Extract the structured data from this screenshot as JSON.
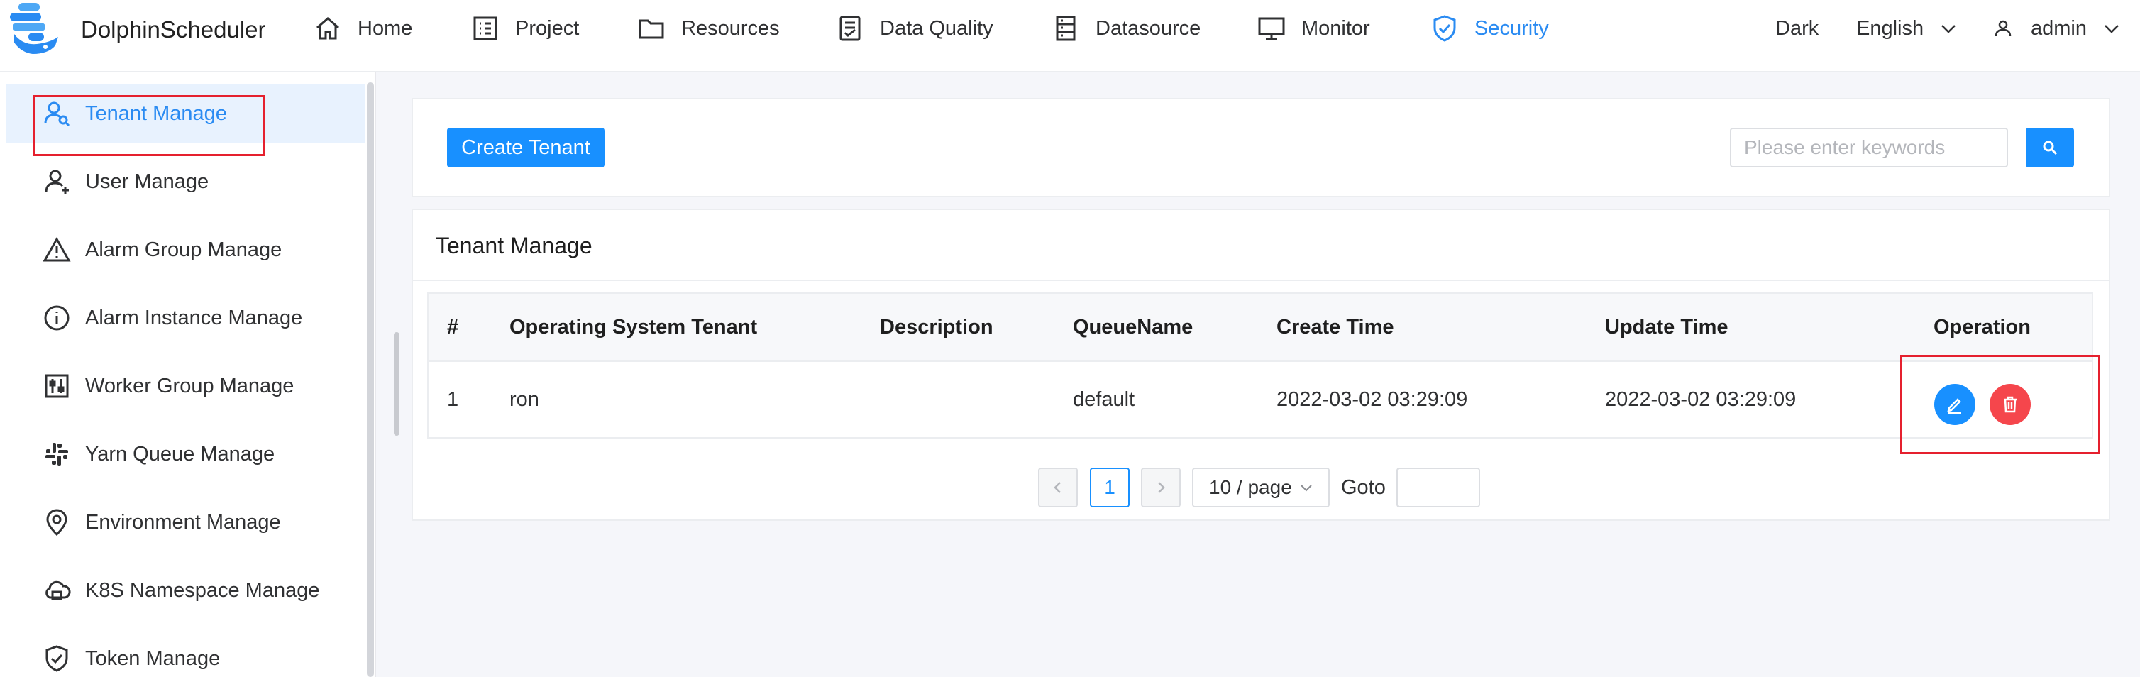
{
  "app": {
    "name": "DolphinScheduler"
  },
  "nav": {
    "items": [
      {
        "label": "Home",
        "icon": "home-icon"
      },
      {
        "label": "Project",
        "icon": "project-icon"
      },
      {
        "label": "Resources",
        "icon": "folder-icon"
      },
      {
        "label": "Data Quality",
        "icon": "data-quality-icon"
      },
      {
        "label": "Datasource",
        "icon": "datasource-icon"
      },
      {
        "label": "Monitor",
        "icon": "monitor-icon"
      },
      {
        "label": "Security",
        "icon": "shield-icon",
        "active": true
      }
    ],
    "theme_label": "Dark",
    "language": "English",
    "user": "admin"
  },
  "sidebar": {
    "items": [
      {
        "label": "Tenant Manage",
        "icon": "tenant-icon",
        "active": true
      },
      {
        "label": "User Manage",
        "icon": "user-icon"
      },
      {
        "label": "Alarm Group Manage",
        "icon": "warning-triangle-icon"
      },
      {
        "label": "Alarm Instance Manage",
        "icon": "info-circle-icon"
      },
      {
        "label": "Worker Group Manage",
        "icon": "sliders-icon"
      },
      {
        "label": "Yarn Queue Manage",
        "icon": "yarn-icon"
      },
      {
        "label": "Environment Manage",
        "icon": "location-pin-icon"
      },
      {
        "label": "K8S Namespace Manage",
        "icon": "cloud-icon"
      },
      {
        "label": "Token Manage",
        "icon": "shield-check-icon"
      }
    ]
  },
  "toolbar": {
    "create_label": "Create Tenant",
    "search_placeholder": "Please enter keywords"
  },
  "section": {
    "title": "Tenant Manage"
  },
  "table": {
    "columns": [
      "#",
      "Operating System Tenant",
      "Description",
      "QueueName",
      "Create Time",
      "Update Time",
      "Operation"
    ],
    "rows": [
      {
        "index": "1",
        "tenant": "ron",
        "description": "",
        "queue": "default",
        "create_time": "2022-03-02 03:29:09",
        "update_time": "2022-03-02 03:29:09"
      }
    ]
  },
  "pagination": {
    "current_page": "1",
    "page_size": "10 / page",
    "goto_label": "Goto"
  },
  "colors": {
    "accent": "#1890ff",
    "danger": "#f5464c",
    "highlight_border": "#e5202e",
    "active_nav": "#2a8bf2"
  }
}
